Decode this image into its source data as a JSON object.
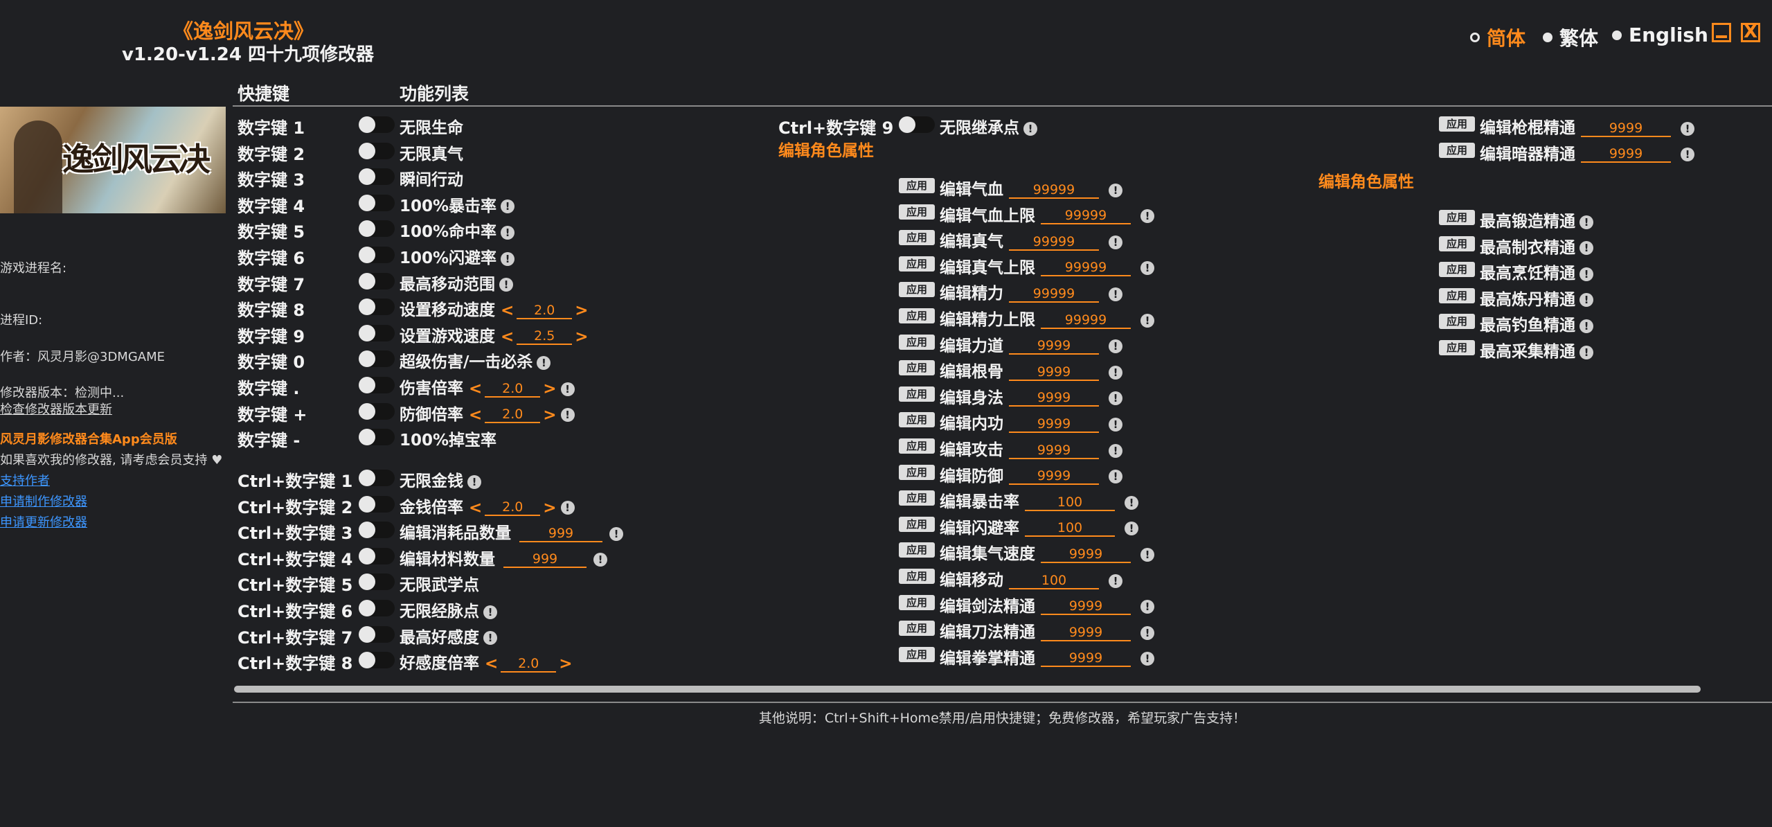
{
  "header": {
    "title": "《逸剑风云决》",
    "subtitle": "v1.20-v1.24 四十九项修改器"
  },
  "languages": [
    {
      "label": "简体",
      "selected": true
    },
    {
      "label": "繁体",
      "selected": false
    },
    {
      "label": "English",
      "selected": false
    }
  ],
  "window": {
    "minimize": "_",
    "close": "X"
  },
  "columns": {
    "hotkey": "快捷键",
    "features": "功能列表"
  },
  "sidebar": {
    "banner_text": "逸剑风云决",
    "process_label": "游戏进程名:",
    "pid_label": "进程ID:",
    "author": "作者：风灵月影@3DMGAME",
    "version": "修改器版本：检测中...",
    "check_update": "检查修改器版本更新",
    "vip": "风灵月影修改器合集App会员版",
    "support_text": "如果喜欢我的修改器, 请考虑会员支持",
    "heart": "♥",
    "links": [
      "支持作者",
      "申请制作修改器",
      "申请更新修改器"
    ]
  },
  "col1": [
    {
      "key": "数字键 1",
      "label": "无限生命"
    },
    {
      "key": "数字键 2",
      "label": "无限真气"
    },
    {
      "key": "数字键 3",
      "label": "瞬间行动"
    },
    {
      "key": "数字键 4",
      "label": "100%暴击率",
      "info": "!"
    },
    {
      "key": "数字键 5",
      "label": "100%命中率",
      "info": "!"
    },
    {
      "key": "数字键 6",
      "label": "100%闪避率",
      "info": "!"
    },
    {
      "key": "数字键 7",
      "label": "最高移动范围",
      "info": "!"
    },
    {
      "key": "数字键 8",
      "label": "设置移动速度",
      "value": "2.0",
      "arrows": true
    },
    {
      "key": "数字键 9",
      "label": "设置游戏速度",
      "value": "2.5",
      "arrows": true
    },
    {
      "key": "数字键 0",
      "label": "超级伤害/一击必杀",
      "info": "!"
    },
    {
      "key": "数字键 .",
      "label": "伤害倍率",
      "value": "2.0",
      "arrows": true,
      "info": "!"
    },
    {
      "key": "数字键 +",
      "label": "防御倍率",
      "value": "2.0",
      "arrows": true,
      "info": "!"
    },
    {
      "key": "数字键 -",
      "label": "100%掉宝率"
    }
  ],
  "col1b": [
    {
      "key": "Ctrl+数字键 1",
      "label": "无限金钱",
      "info": "!"
    },
    {
      "key": "Ctrl+数字键 2",
      "label": "金钱倍率",
      "value": "2.0",
      "arrows": true,
      "info": "!"
    },
    {
      "key": "Ctrl+数字键 3",
      "label": "编辑消耗品数量",
      "value": "999",
      "info": "!"
    },
    {
      "key": "Ctrl+数字键 4",
      "label": "编辑材料数量",
      "value": "999",
      "info": "!"
    },
    {
      "key": "Ctrl+数字键 5",
      "label": "无限武学点"
    },
    {
      "key": "Ctrl+数字键 6",
      "label": "无限经脉点",
      "info": "!"
    },
    {
      "key": "Ctrl+数字键 7",
      "label": "最高好感度",
      "info": "!"
    },
    {
      "key": "Ctrl+数字键 8",
      "label": "好感度倍率",
      "value": "2.0",
      "arrows": true
    }
  ],
  "col2": {
    "hotkey_row": {
      "key": "Ctrl+数字键 9",
      "label": "无限继承点",
      "info": "!"
    },
    "section": "编辑角色属性",
    "apply": "应用",
    "items": [
      {
        "label": "编辑气血",
        "value": "99999"
      },
      {
        "label": "编辑气血上限",
        "value": "99999"
      },
      {
        "label": "编辑真气",
        "value": "99999"
      },
      {
        "label": "编辑真气上限",
        "value": "99999"
      },
      {
        "label": "编辑精力",
        "value": "99999"
      },
      {
        "label": "编辑精力上限",
        "value": "99999"
      },
      {
        "label": "编辑力道",
        "value": "9999"
      },
      {
        "label": "编辑根骨",
        "value": "9999"
      },
      {
        "label": "编辑身法",
        "value": "9999"
      },
      {
        "label": "编辑内功",
        "value": "9999"
      },
      {
        "label": "编辑攻击",
        "value": "9999"
      },
      {
        "label": "编辑防御",
        "value": "9999"
      },
      {
        "label": "编辑暴击率",
        "value": "100"
      },
      {
        "label": "编辑闪避率",
        "value": "100"
      },
      {
        "label": "编辑集气速度",
        "value": "9999"
      },
      {
        "label": "编辑移动",
        "value": "100"
      },
      {
        "label": "编辑剑法精通",
        "value": "9999"
      },
      {
        "label": "编辑刀法精通",
        "value": "9999"
      },
      {
        "label": "编辑拳掌精通",
        "value": "9999"
      }
    ]
  },
  "col3": {
    "top": [
      {
        "label": "编辑枪棍精通",
        "value": "9999"
      },
      {
        "label": "编辑暗器精通",
        "value": "9999"
      }
    ],
    "section": "编辑角色属性",
    "items": [
      {
        "label": "最高锻造精通"
      },
      {
        "label": "最高制衣精通"
      },
      {
        "label": "最高烹饪精通"
      },
      {
        "label": "最高炼丹精通"
      },
      {
        "label": "最高钓鱼精通"
      },
      {
        "label": "最高采集精通"
      }
    ]
  },
  "footer": "其他说明：Ctrl+Shift+Home禁用/启用快捷键；免费修改器，希望玩家广告支持！"
}
